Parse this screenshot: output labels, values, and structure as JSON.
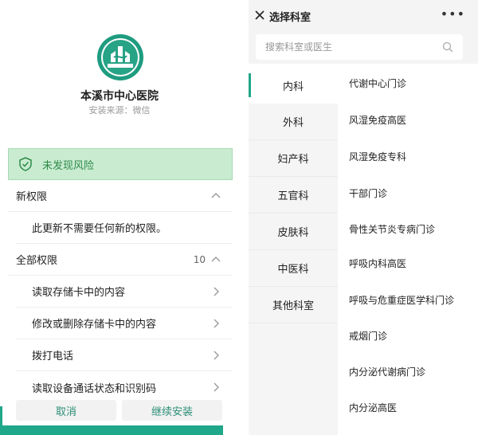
{
  "install_dialog": {
    "app_name": "本溪市中心医院",
    "install_source": "安装来源：微信",
    "risk_status": "未发现风险",
    "new_permissions": {
      "title": "新权限",
      "message": "此更新不需要任何新的权限。"
    },
    "all_permissions": {
      "title": "全部权限",
      "count": "10",
      "items": [
        "读取存储卡中的内容",
        "修改或删除存储卡中的内容",
        "拨打电话",
        "读取设备通话状态和识别码"
      ]
    },
    "buttons": {
      "cancel": "取消",
      "continue_install": "继续安装"
    }
  },
  "department_picker": {
    "title": "选择科室",
    "more_label": "•••",
    "search": {
      "placeholder": "搜索科室或医生",
      "value": ""
    },
    "categories": [
      "内科",
      "外科",
      "妇产科",
      "五官科",
      "皮肤科",
      "中医科",
      "其他科室"
    ],
    "active_category": "内科",
    "departments": [
      "代谢中心门诊",
      "风湿免疫高医",
      "风湿免疫专科",
      "干部门诊",
      "骨性关节炎专病门诊",
      "呼吸内科高医",
      "呼吸与危重症医学科门诊",
      "戒烟门诊",
      "内分泌代谢病门诊",
      "内分泌高医"
    ]
  },
  "colors": {
    "accent_teal": "#1fa78a",
    "safe_green_bg": "#c9ecd1",
    "safe_green_text": "#2f8a48",
    "button_text": "#2c8f76"
  },
  "icons": {
    "logo": "hospital-emblem-icon",
    "risk": "shield-check-icon",
    "collapse": "chevron-up-icon",
    "item": "chevron-right-icon",
    "close": "close-icon",
    "search": "search-icon"
  }
}
